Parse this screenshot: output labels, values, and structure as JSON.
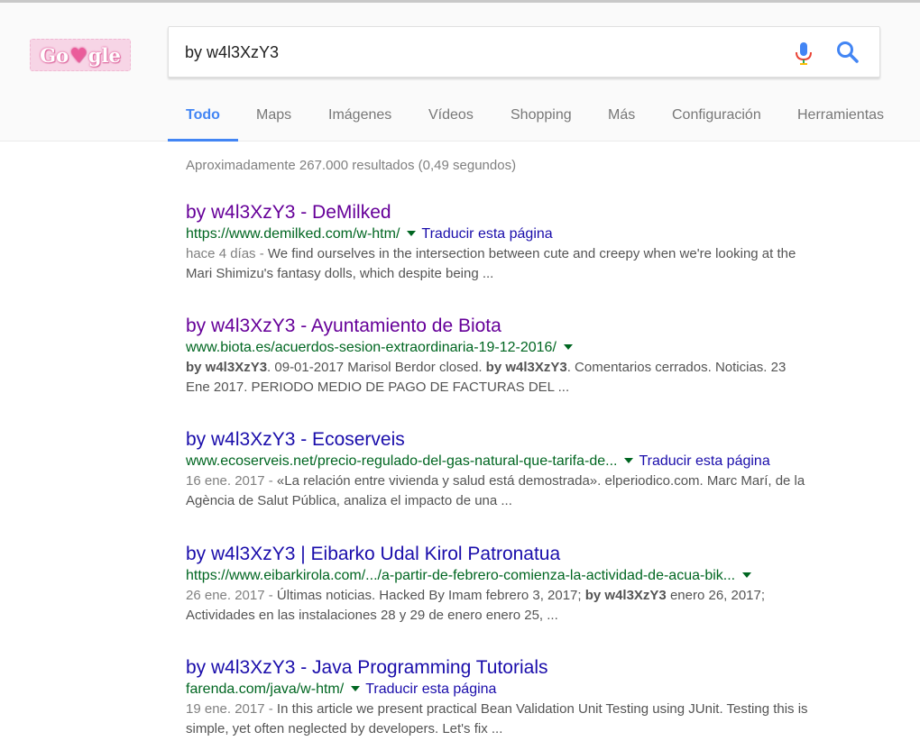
{
  "logo": {
    "part1": "Go",
    "part2": "gle",
    "heart": "♥"
  },
  "search": {
    "value": "by w4l3XzY3"
  },
  "tabs": [
    {
      "label": "Todo",
      "active": true
    },
    {
      "label": "Maps"
    },
    {
      "label": "Imágenes"
    },
    {
      "label": "Vídeos"
    },
    {
      "label": "Shopping"
    },
    {
      "label": "Más"
    },
    {
      "label": "Configuración"
    },
    {
      "label": "Herramientas"
    }
  ],
  "stats": "Aproximadamente 267.000 resultados (0,49 segundos)",
  "results": [
    {
      "title": "by w4l3XzY3 - DeMilked",
      "url": "https://www.demilked.com/w-htm/",
      "translate": "Traducir esta página",
      "date": "hace 4 días - ",
      "snippet_l1": "We find ourselves in the intersection between cute and creepy when we're looking at the",
      "snippet_l2": "Mari Shimizu's fantasy dolls, which despite being ..."
    },
    {
      "title": "by w4l3XzY3 - Ayuntamiento de Biota",
      "url": "www.biota.es/acuerdos-sesion-extraordinaria-19-12-2016/",
      "bold1": "by w4l3XzY3",
      "text1": ". 09-01-2017 Marisol Berdor closed. ",
      "bold2": "by w4l3XzY3",
      "text2": ". Comentarios cerrados. Noticias. 23",
      "snippet_l2": "Ene 2017. PERIODO MEDIO DE PAGO DE FACTURAS DEL ..."
    },
    {
      "title": "by w4l3XzY3 - Ecoserveis",
      "url": "www.ecoserveis.net/precio-regulado-del-gas-natural-que-tarifa-de...",
      "translate": "Traducir esta página",
      "date": "16 ene. 2017 - ",
      "snippet_l1": "«La relación entre vivienda y salud está demostrada». elperiodico.com. Marc Marí, de la",
      "snippet_l2": "Agència de Salut Pública, analiza el impacto de una ..."
    },
    {
      "title": "by w4l3XzY3 | Eibarko Udal Kirol Patronatua",
      "url": "https://www.eibarkirola.com/.../a-partir-de-febrero-comienza-la-actividad-de-acua-bik...",
      "date": "26 ene. 2017 - ",
      "text1": "Últimas noticias. Hacked By Imam febrero 3, 2017; ",
      "bold1": "by w4l3XzY3",
      "text2": " enero 26, 2017;",
      "snippet_l2": "Actividades en las instalaciones 28 y 29 de enero enero 25, ..."
    },
    {
      "title": "by w4l3XzY3 - Java Programming Tutorials",
      "url": "farenda.com/java/w-htm/",
      "translate": "Traducir esta página",
      "date": "19 ene. 2017 - ",
      "snippet_l1": "In this article we present practical Bean Validation Unit Testing using JUnit. Testing this is",
      "snippet_l2": "simple, yet often neglected by developers. Let's fix ..."
    }
  ],
  "colors": {
    "accent": "#4285f4",
    "link": "#1a0dab",
    "visited": "#660099",
    "url": "#006621",
    "snippet": "#545454"
  }
}
